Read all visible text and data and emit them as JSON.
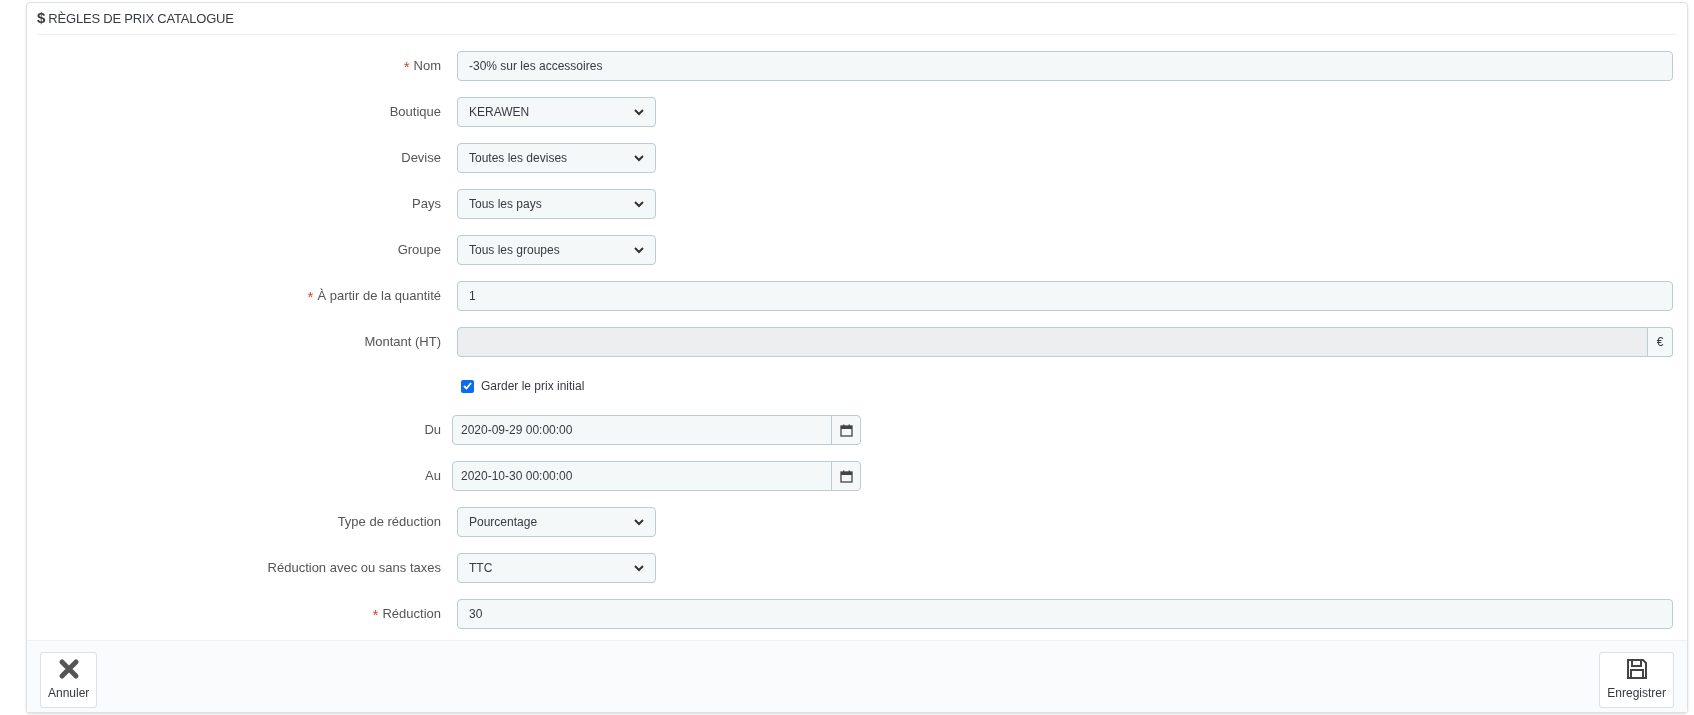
{
  "panel": {
    "title": "RÈGLES DE PRIX CATALOGUE",
    "title_icon": "$"
  },
  "fields": [
    {
      "kind": "text",
      "label": "Nom",
      "required_mark": "*",
      "value": "-30% sur les accessoires"
    },
    {
      "kind": "select",
      "label": "Boutique",
      "value": "KERAWEN"
    },
    {
      "kind": "select",
      "label": "Devise",
      "value": "Toutes les devises"
    },
    {
      "kind": "select",
      "label": "Pays",
      "value": "Tous les pays"
    },
    {
      "kind": "select",
      "label": "Groupe",
      "value": "Tous les groupes"
    },
    {
      "kind": "text",
      "label": "À partir de la quantité",
      "required_mark": "*",
      "value": "1"
    },
    {
      "kind": "addon",
      "label": "Montant (HT)",
      "disabled": true,
      "addon": "€"
    },
    {
      "kind": "checkbox",
      "label": "Garder le prix initial",
      "checked": true
    },
    {
      "kind": "date",
      "label": "Du",
      "value": "2020-09-29 00:00:00"
    },
    {
      "kind": "date",
      "label": "Au",
      "value": "2020-10-30 00:00:00"
    },
    {
      "kind": "select",
      "label": "Type de réduction",
      "value": "Pourcentage"
    },
    {
      "kind": "select",
      "label": "Réduction avec ou sans taxes",
      "value": "TTC"
    },
    {
      "kind": "text",
      "label": "Réduction",
      "required_mark": "*",
      "value": "30"
    }
  ],
  "footer_buttons": [
    {
      "kind": "cancel",
      "label": "Annuler"
    },
    {
      "kind": "save",
      "label": "Enregistrer"
    }
  ]
}
